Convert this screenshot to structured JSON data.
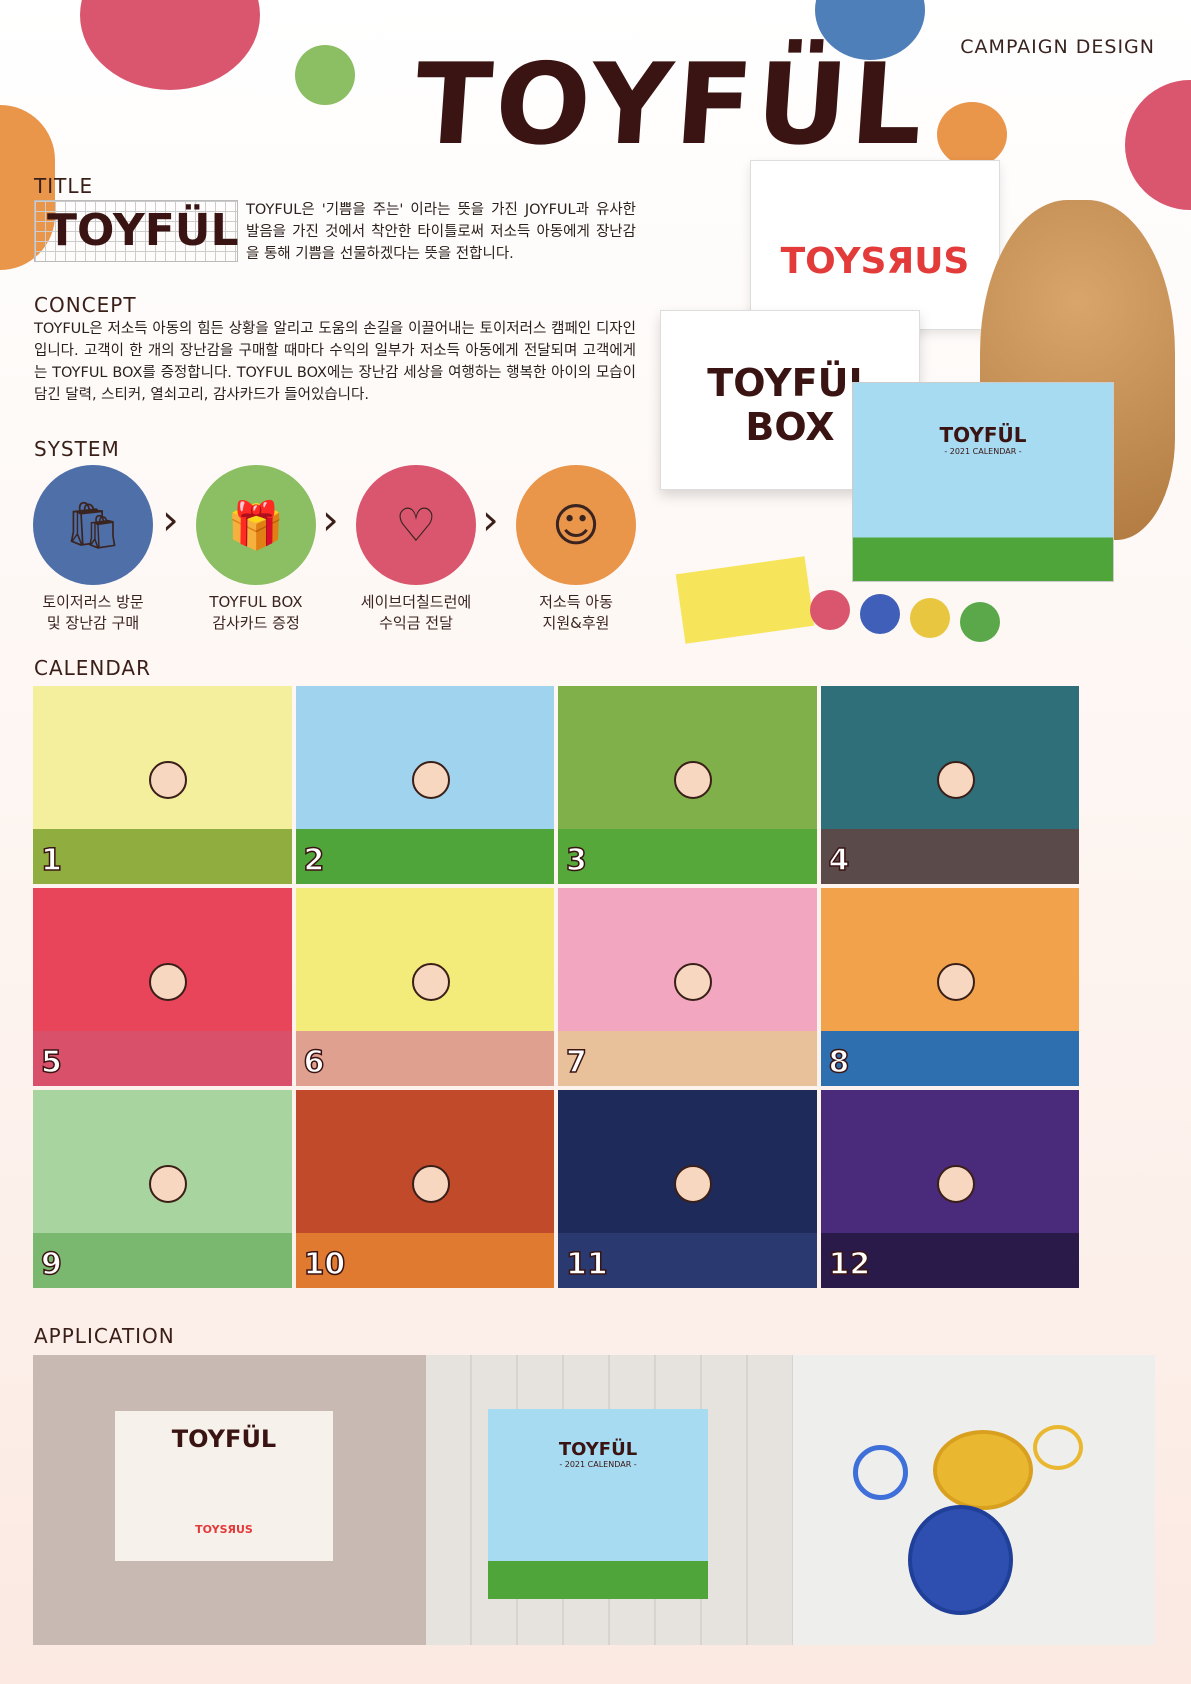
{
  "header": {
    "logo": "TOYFÜL",
    "tag": "CAMPAIGN DESIGN"
  },
  "title_section": {
    "heading": "TITLE",
    "logo": "TOYFÜL",
    "text": "TOYFUL은 '기쁨을 주는' 이라는 뜻을 가진 JOYFUL과 유사한 발음을 가진 것에서 착안한 타이틀로써 저소득 아동에게 장난감을 통해 기쁨을 선물하겠다는 뜻을 전합니다."
  },
  "concept": {
    "heading": "CONCEPT",
    "text": "TOYFUL은 저소득 아동의 힘든 상황을 알리고 도움의 손길을 이끌어내는 토이저러스 캠페인 디자인 입니다. 고객이 한 개의 장난감을 구매할 때마다 수익의 일부가 저소득 아동에게 전달되며 고객에게는 TOYFUL BOX를 증정합니다. TOYFUL BOX에는 장난감 세상을 여행하는 행복한 아이의 모습이 담긴 달력, 스티커, 열쇠고리, 감사카드가 들어있습니다."
  },
  "system": {
    "heading": "SYSTEM",
    "steps": [
      {
        "line1": "토이저러스 방문",
        "line2": "및 장난감 구매",
        "color": "#4f6fa8",
        "icon": "shopping-bag-bear-icon"
      },
      {
        "line1": "TOYFUL BOX",
        "line2": "감사카드 증정",
        "color": "#8cbf63",
        "icon": "gift-box-icon"
      },
      {
        "line1": "세이브더칠드런에",
        "line2": "수익금 전달",
        "color": "#d9566e",
        "icon": "heart-child-icon"
      },
      {
        "line1": "저소득 아동",
        "line2": "지원&후원",
        "color": "#e9954a",
        "icon": "baby-face-icon"
      }
    ]
  },
  "product": {
    "brand": "TOYSЯUS",
    "box_line1": "TOYFÜL",
    "box_line2": "BOX",
    "calendar_title": "TOYFÜL",
    "calendar_sub": "- 2021 CALENDAR -"
  },
  "calendar": {
    "heading": "CALENDAR",
    "months": [
      {
        "n": "1",
        "bg": "#f3ef9c",
        "ground": "#8fae3f"
      },
      {
        "n": "2",
        "bg": "#9fd3ee",
        "ground": "#4fa43a"
      },
      {
        "n": "3",
        "bg": "#7fb04a",
        "ground": "#56a83a"
      },
      {
        "n": "4",
        "bg": "#2f6f7a",
        "ground": "#5a4a4a"
      },
      {
        "n": "5",
        "bg": "#e8455a",
        "ground": "#d9506a"
      },
      {
        "n": "6",
        "bg": "#f3ec7a",
        "ground": "#e0a090"
      },
      {
        "n": "7",
        "bg": "#f2a6c0",
        "ground": "#e8c09a"
      },
      {
        "n": "8",
        "bg": "#f2a24a",
        "ground": "#2e6fb0"
      },
      {
        "n": "9",
        "bg": "#a8d4a0",
        "ground": "#7ab870"
      },
      {
        "n": "10",
        "bg": "#c04a2a",
        "ground": "#e07a30"
      },
      {
        "n": "11",
        "bg": "#1e2a5a",
        "ground": "#2a3a70"
      },
      {
        "n": "12",
        "bg": "#4a2a7a",
        "ground": "#2a1a4a"
      }
    ]
  },
  "application": {
    "heading": "APPLICATION",
    "card_title": "TOYFÜL",
    "card_brand": "TOYSЯUS",
    "calendar_title": "TOYFÜL",
    "calendar_sub": "- 2021 CALENDAR -"
  }
}
